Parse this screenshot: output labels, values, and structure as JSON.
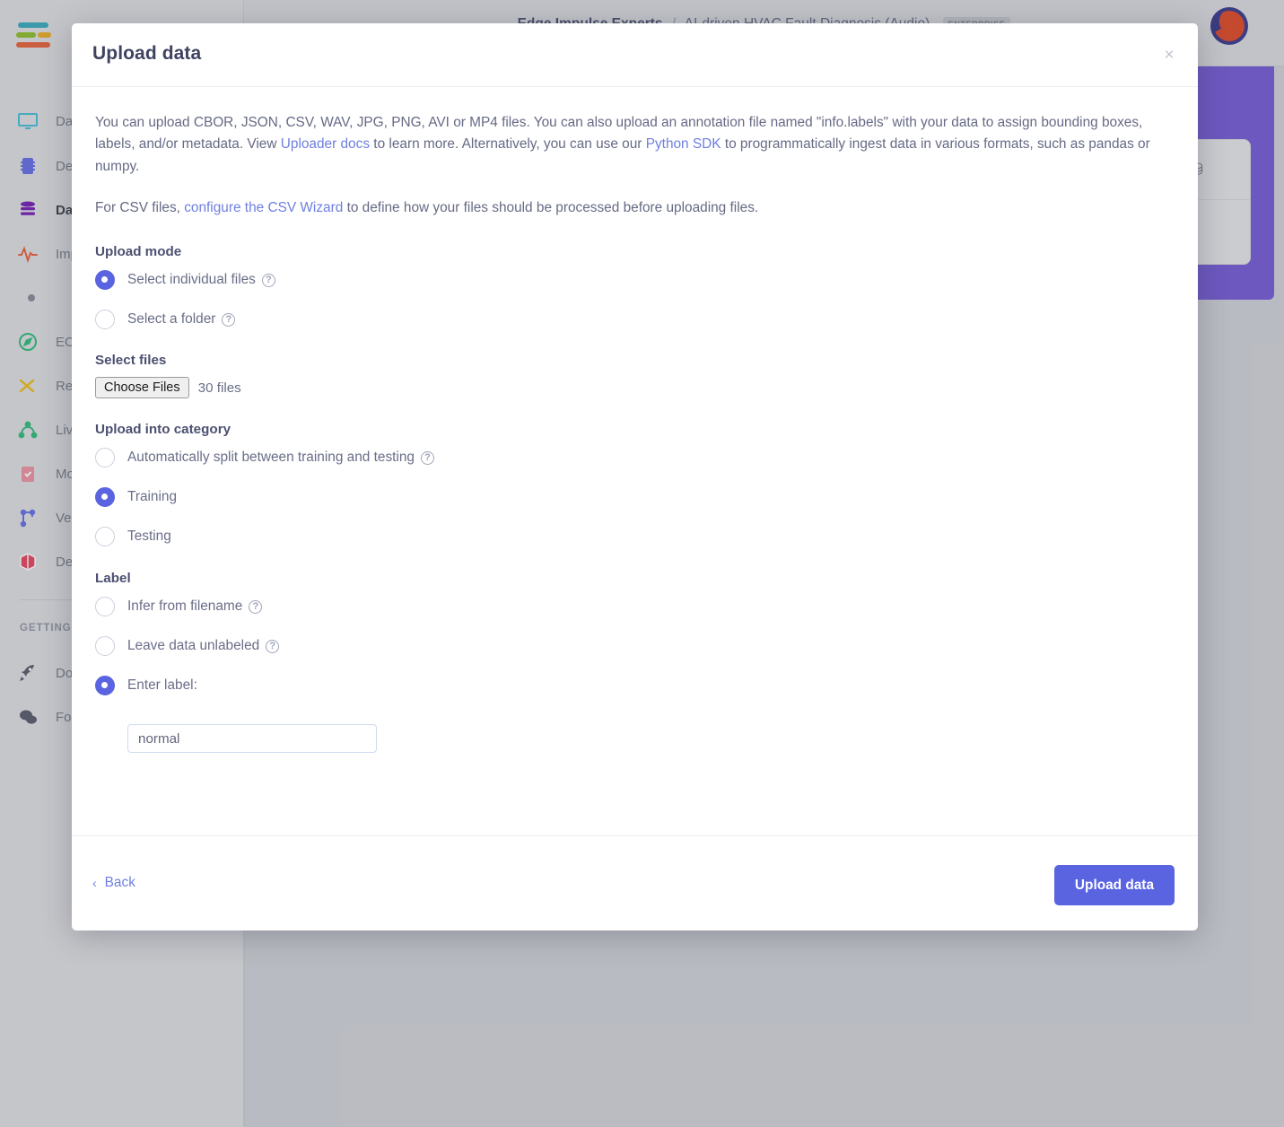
{
  "background": {
    "breadcrumb": {
      "org": "Edge Impulse Experts",
      "separator": "/",
      "project": "AI-driven HVAC Fault Diagnosis (Audio)",
      "badge": "ENTERPRISE"
    },
    "sidebar": {
      "section_title": "GETTING STARTED",
      "items": [
        {
          "label": "Dashboard",
          "icon": "monitor-icon",
          "color": "#3bb8d4"
        },
        {
          "label": "Devices",
          "icon": "chip-icon",
          "color": "#5a63e0"
        },
        {
          "label": "Data acquisition",
          "icon": "database-icon",
          "color": "#6a0fad"
        },
        {
          "label": "Impulse design",
          "icon": "pulse-icon",
          "color": "#e4572e"
        },
        {
          "label": "EON Tuner",
          "icon": "compass-icon",
          "color": "#22b573"
        },
        {
          "label": "Retrain model",
          "icon": "shuffle-icon",
          "color": "#e8b600"
        },
        {
          "label": "Live classification",
          "icon": "graph-node-icon",
          "color": "#22b573"
        },
        {
          "label": "Model testing",
          "icon": "clipboard-check-icon",
          "color": "#e98a9a"
        },
        {
          "label": "Versioning",
          "icon": "branch-icon",
          "color": "#5a63e0"
        },
        {
          "label": "Deployment",
          "icon": "cube-icon",
          "color": "#e03a52"
        },
        {
          "label": "Documentation",
          "icon": "rocket-icon",
          "color": "#4c4f5e"
        },
        {
          "label": "Forums",
          "icon": "chat-icon",
          "color": "#4c4f5e"
        }
      ]
    },
    "panel": {
      "usb_icon": "usb-icon"
    }
  },
  "modal": {
    "title": "Upload data",
    "close_label": "×",
    "intro": {
      "part1": "You can upload CBOR, JSON, CSV, WAV, JPG, PNG, AVI or MP4 files. You can also upload an annotation file named \"info.labels\" with your data to assign bounding boxes, labels, and/or metadata. View ",
      "link1": "Uploader docs",
      "part2": " to learn more. Alternatively, you can use our ",
      "link2": "Python SDK",
      "part3": " to programmatically ingest data in various formats, such as pandas or numpy."
    },
    "csv_note": {
      "part1": "For CSV files, ",
      "link": "configure the CSV Wizard",
      "part2": " to define how your files should be processed before uploading files."
    },
    "upload_mode": {
      "title": "Upload mode",
      "options": [
        {
          "label": "Select individual files",
          "checked": true,
          "help": "?"
        },
        {
          "label": "Select a folder",
          "checked": false,
          "help": "?"
        }
      ]
    },
    "select_files": {
      "title": "Select files",
      "button_label": "Choose Files",
      "file_count": "30 files"
    },
    "category": {
      "title": "Upload into category",
      "options": [
        {
          "label": "Automatically split between training and testing",
          "checked": false,
          "help": "?"
        },
        {
          "label": "Training",
          "checked": true,
          "help": ""
        },
        {
          "label": "Testing",
          "checked": false,
          "help": ""
        }
      ]
    },
    "label": {
      "title": "Label",
      "options": [
        {
          "label": "Infer from filename",
          "checked": false,
          "help": "?"
        },
        {
          "label": "Leave data unlabeled",
          "checked": false,
          "help": "?"
        },
        {
          "label": "Enter label:",
          "checked": true,
          "help": ""
        }
      ],
      "input_value": "normal",
      "input_placeholder": ""
    },
    "footer": {
      "back_label": "Back",
      "back_chevron": "‹",
      "submit_label": "Upload data"
    }
  },
  "colors": {
    "accent": "#5a63e0",
    "link": "#6f7fe0",
    "title": "#3f4260",
    "body_text": "#666a85",
    "panel_purple": "#6b4fd0"
  }
}
